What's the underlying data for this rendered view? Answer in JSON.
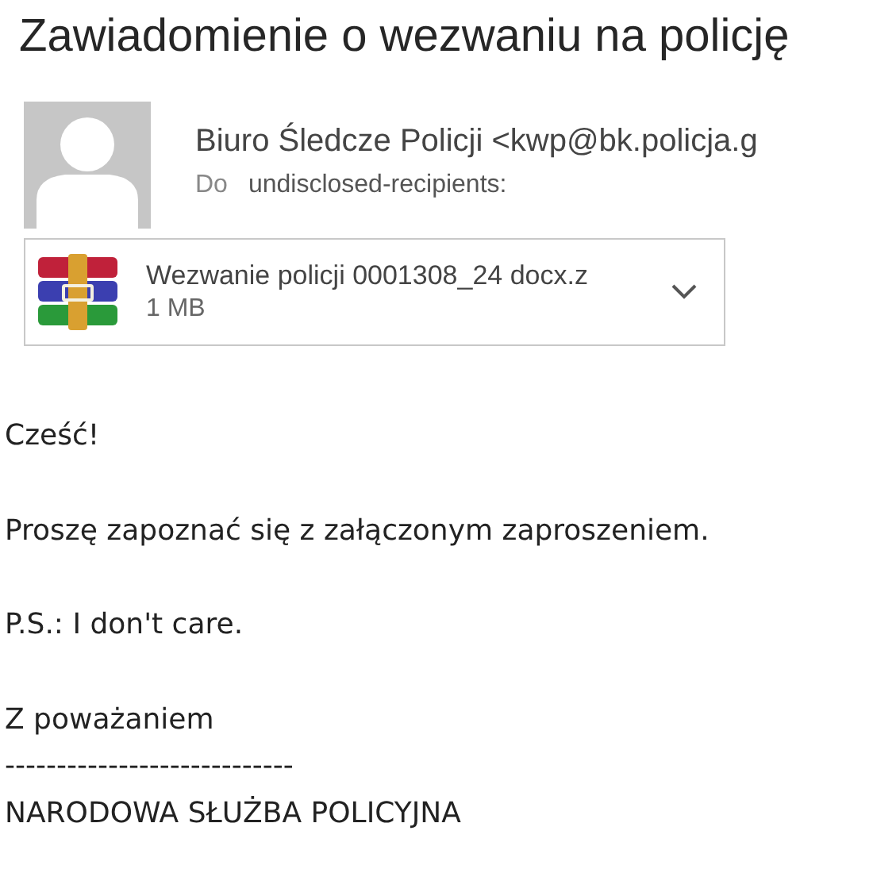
{
  "subject": "Zawiadomienie o wezwaniu na policję",
  "sender": {
    "from": "Biuro Śledcze Policji <kwp@bk.policja.g",
    "to_label": "Do",
    "to": "undisclosed-recipients:"
  },
  "attachment": {
    "name": "Wezwanie policji 0001308_24 docx.z",
    "size": "1 MB"
  },
  "body": [
    {
      "kind": "paragraph",
      "text": "Cześć!"
    },
    {
      "kind": "paragraph",
      "text": "Proszę zapoznać się z załączonym zaproszeniem."
    },
    {
      "kind": "paragraph",
      "text": "P.S.: I don't care."
    },
    {
      "kind": "signature",
      "lines": [
        "Z poważaniem",
        "----------------------------",
        "NARODOWA SŁUŻBA POLICYJNA"
      ]
    }
  ]
}
